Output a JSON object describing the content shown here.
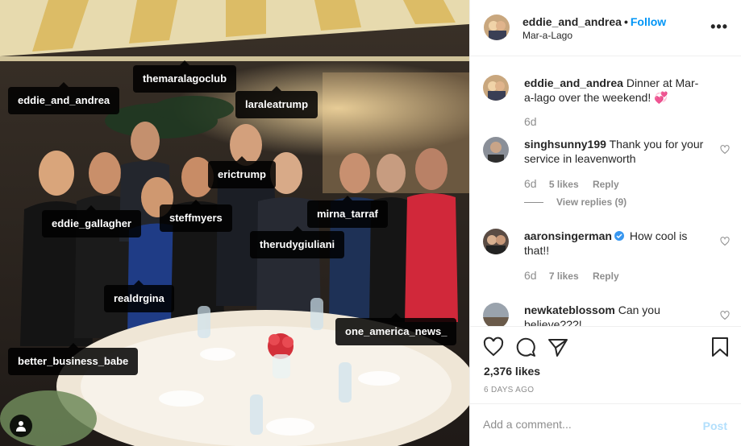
{
  "post": {
    "author": "eddie_and_andrea",
    "follow_label": "Follow",
    "dot": "•",
    "location": "Mar-a-Lago",
    "more_label": "•••"
  },
  "photo_tags": [
    "eddie_and_andrea",
    "themaralagoclub",
    "laraleatrump",
    "erictrump",
    "eddie_gallagher",
    "steffmyers",
    "mirna_tarraf",
    "therudygiuliani",
    "realdrgina",
    "one_america_news_",
    "better_business_babe"
  ],
  "caption": {
    "user": "eddie_and_andrea",
    "text": "Dinner at Mar-a-lago over the weekend! 💞",
    "age": "6d"
  },
  "comments": [
    {
      "user": "singhsunny199",
      "text": "Thank you for your service in leavenworth",
      "age": "6d",
      "likes": "5 likes",
      "reply": "Reply",
      "view_replies": "View replies (9)"
    },
    {
      "user": "aaronsingerman",
      "text": "How cool is that!!",
      "age": "6d",
      "likes": "7 likes",
      "reply": "Reply"
    },
    {
      "user": "newkateblossom",
      "text": "Can you believe???!"
    }
  ],
  "stats": {
    "likes": "2,376 likes",
    "date": "6 DAYS AGO"
  },
  "add_comment": {
    "placeholder": "Add a comment...",
    "post_label": "Post"
  },
  "icons": [
    "heart-icon",
    "comment-icon",
    "share-icon",
    "bookmark-icon",
    "user-tag-icon",
    "verified-icon"
  ],
  "colors": {
    "link": "#0095f6",
    "muted": "#8e8e8e",
    "post_disabled": "#b2dffc",
    "verified": "#3897f0"
  }
}
